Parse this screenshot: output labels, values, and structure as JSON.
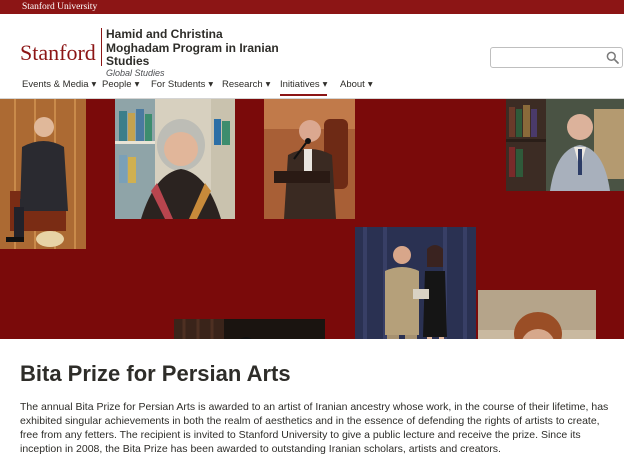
{
  "top_bar": {
    "university_link": "Stanford University"
  },
  "header": {
    "wordmark": "Stanford",
    "program_name": "Hamid and Christina Moghadam Program in Iranian Studies",
    "program_sub": "Global Studies"
  },
  "search": {
    "placeholder": "",
    "icon": "search-icon"
  },
  "nav": {
    "items": [
      {
        "label": "Events & Media",
        "icon": "chevron-down-icon"
      },
      {
        "label": "People",
        "icon": "chevron-down-icon"
      },
      {
        "label": "For Students",
        "icon": "chevron-down-icon"
      },
      {
        "label": "Research",
        "icon": "chevron-down-icon"
      },
      {
        "label": "Initiatives",
        "icon": "chevron-down-icon",
        "active": true
      },
      {
        "label": "About",
        "icon": "chevron-down-icon"
      }
    ],
    "chevron": "▾"
  },
  "colors": {
    "cardinal": "#8c1515",
    "collage_bg": "#7a0a0a",
    "text": "#2e2d29"
  },
  "main": {
    "title": "Bita Prize for Persian Arts",
    "intro": "The annual Bita Prize for Persian Arts is awarded to an artist of Iranian ancestry whose work, in the course of their lifetime, has exhibited singular achievements in both the realm of aesthetics and in the essence of defending the rights of artists to create, free from any fetters. The recipient is invited to Stanford University to give a public lecture and receive the prize. Since its inception in 2008, the Bita Prize has been awarded to outstanding Iranian scholars, artists and creators."
  }
}
